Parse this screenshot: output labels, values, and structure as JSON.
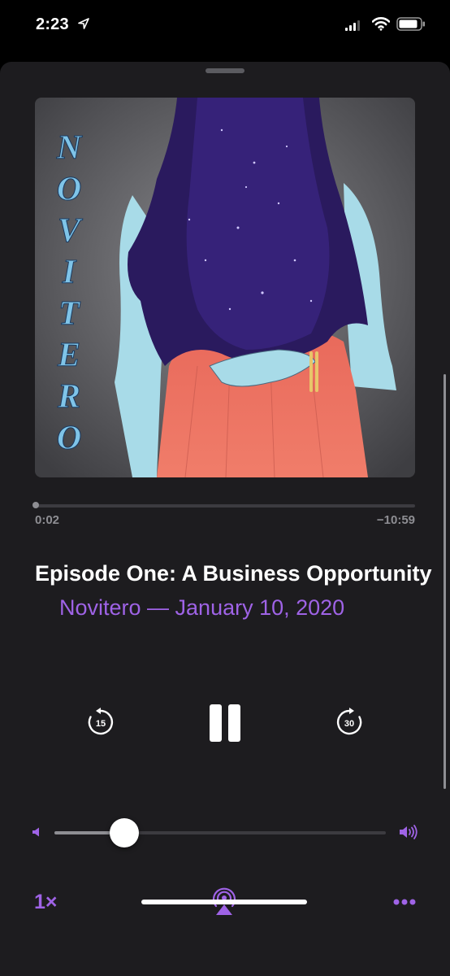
{
  "status_bar": {
    "time": "2:23",
    "icons": [
      "location-arrow-icon",
      "cellular-signal-icon",
      "wifi-icon",
      "battery-icon"
    ]
  },
  "artwork": {
    "vertical_text": "NOVITERO",
    "description_icon": "podcast-cover-art"
  },
  "player": {
    "elapsed": "0:02",
    "remaining": "−10:59",
    "progress": 0.003,
    "title": "Episode One: A Business Opportunity",
    "subtitle": "Novitero — January 10, 2020",
    "skip_back_seconds": "15",
    "skip_forward_seconds": "30",
    "volume": 0.21,
    "speed_label": "1×"
  },
  "colors": {
    "accent": "#9f63e6",
    "sheet_background": "#1d1c1f",
    "background": "#000000"
  }
}
